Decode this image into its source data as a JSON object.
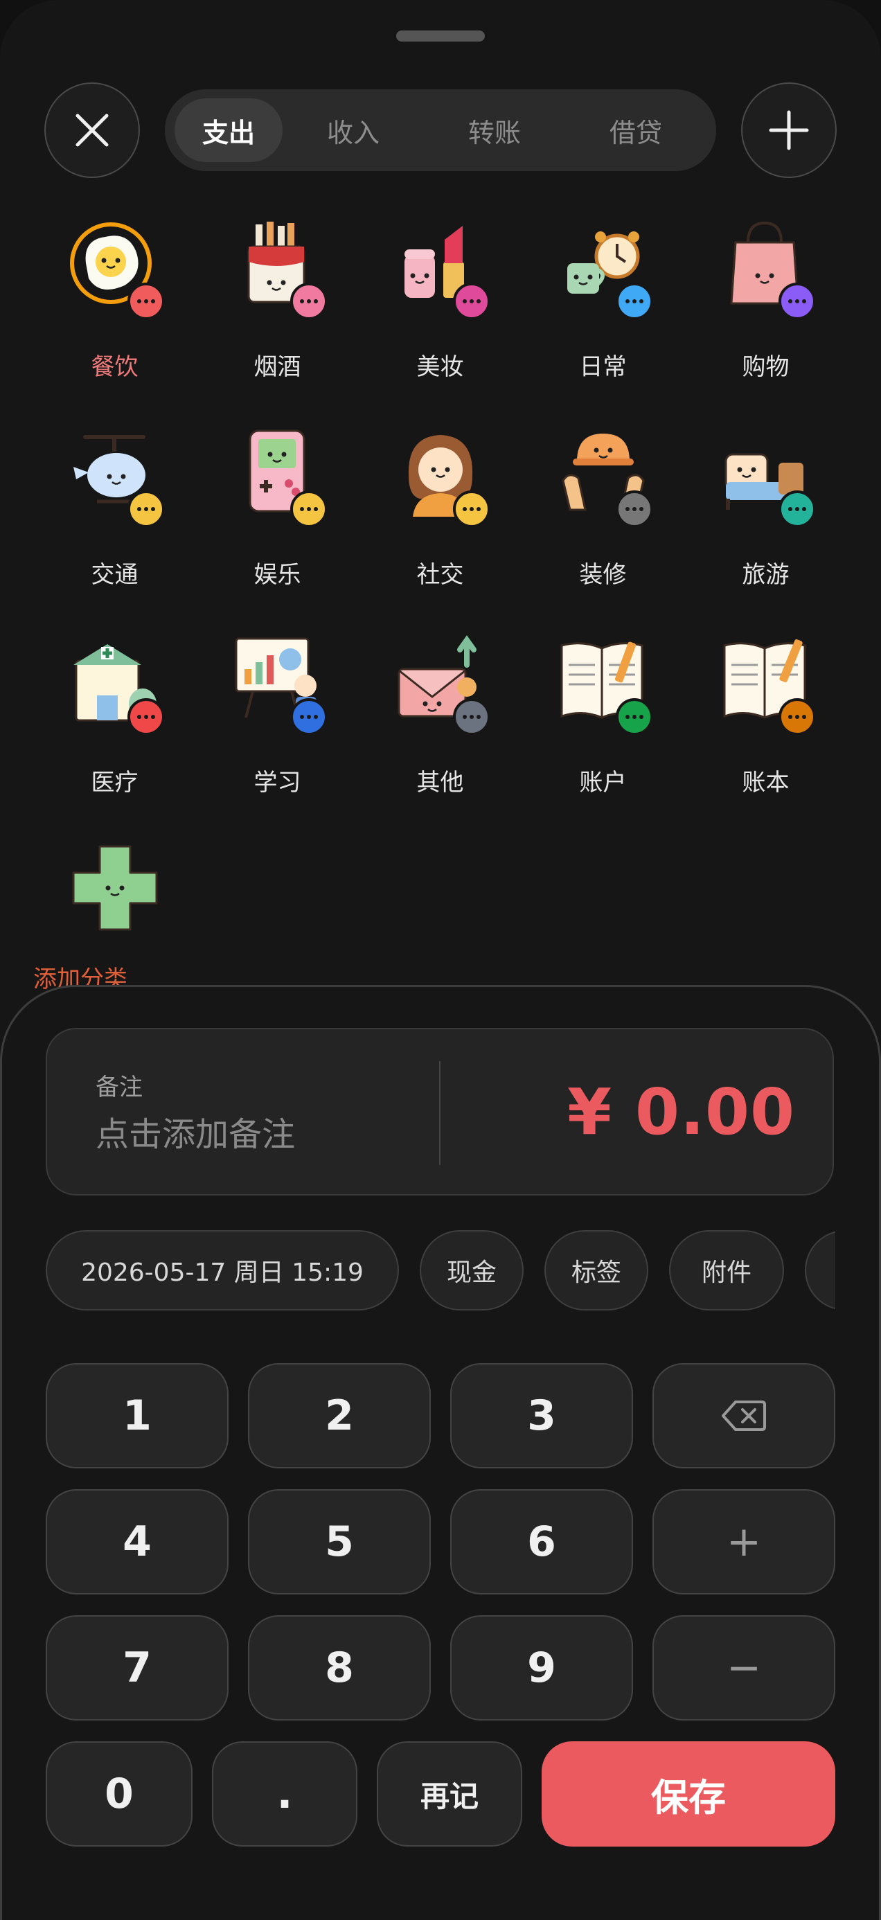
{
  "header": {
    "close_icon": "close-icon",
    "add_icon": "plus-icon",
    "tabs": [
      {
        "label": "支出",
        "active": true
      },
      {
        "label": "收入",
        "active": false
      },
      {
        "label": "转账",
        "active": false
      },
      {
        "label": "借贷",
        "active": false
      }
    ]
  },
  "categories": [
    {
      "label": "餐饮",
      "icon": "fried-egg-icon",
      "badge_color": "#f05b5b",
      "selected": true
    },
    {
      "label": "烟酒",
      "icon": "cigarette-pack-icon",
      "badge_color": "#f07aa0"
    },
    {
      "label": "美妆",
      "icon": "lipstick-icon",
      "badge_color": "#e04a9a"
    },
    {
      "label": "日常",
      "icon": "coffee-alarm-clock-icon",
      "badge_color": "#3fa9f5"
    },
    {
      "label": "购物",
      "icon": "shopping-bag-icon",
      "badge_color": "#8b5cf6"
    },
    {
      "label": "交通",
      "icon": "helicopter-icon",
      "badge_color": "#f5c542"
    },
    {
      "label": "娱乐",
      "icon": "game-console-icon",
      "badge_color": "#f5c542"
    },
    {
      "label": "社交",
      "icon": "person-icon",
      "badge_color": "#f5c542"
    },
    {
      "label": "装修",
      "icon": "hard-hat-gloves-icon",
      "badge_color": "#777777"
    },
    {
      "label": "旅游",
      "icon": "bed-luggage-icon",
      "badge_color": "#22b39a"
    },
    {
      "label": "医疗",
      "icon": "hospital-icon",
      "badge_color": "#f04848"
    },
    {
      "label": "学习",
      "icon": "presentation-board-icon",
      "badge_color": "#2f6fe0"
    },
    {
      "label": "其他",
      "icon": "envelope-icon",
      "badge_color": "#6b7280"
    },
    {
      "label": "账户",
      "icon": "open-ledger-icon",
      "badge_color": "#16a34a"
    },
    {
      "label": "账本",
      "icon": "ledger-pencil-icon",
      "badge_color": "#d97706"
    },
    {
      "label": "添加分类",
      "icon": "green-plus-icon",
      "badge_color": ""
    }
  ],
  "note": {
    "label": "备注",
    "placeholder": "点击添加备注"
  },
  "amount": {
    "currency": "¥",
    "value": "0.00"
  },
  "chips": [
    {
      "label": "2026-05-17 周日 15:19"
    },
    {
      "label": "现金"
    },
    {
      "label": "标签"
    },
    {
      "label": "附件"
    }
  ],
  "keypad": {
    "digits": [
      "1",
      "2",
      "3",
      "4",
      "5",
      "6",
      "7",
      "8",
      "9"
    ],
    "backspace_icon": "backspace-icon",
    "plus": "+",
    "minus": "−",
    "zero": "0",
    "dot": ".",
    "again": "再记",
    "save": "保存"
  },
  "colors": {
    "accent": "#ea5a5f",
    "background": "#161616",
    "surface": "#242424"
  }
}
